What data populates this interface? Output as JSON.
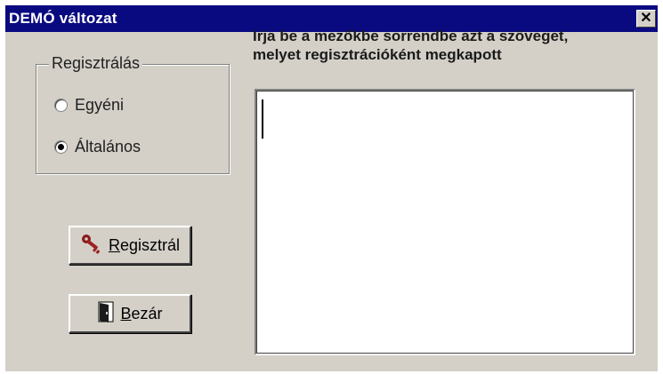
{
  "window": {
    "title": "DEMÓ változat",
    "close_glyph": "✕"
  },
  "registration_group": {
    "label": "Regisztrálás",
    "options": [
      {
        "label": "Egyéni",
        "selected": false
      },
      {
        "label": "Általános",
        "selected": true
      }
    ]
  },
  "buttons": {
    "register": {
      "label_first": "R",
      "label_rest": "egisztrál",
      "icon": "key-icon"
    },
    "close": {
      "label_first": "B",
      "label_rest": "ezár",
      "icon": "door-icon"
    }
  },
  "instruction": {
    "line1": "Irja be a mezőkbe sorrendbe  azt a szöveget,",
    "line2": "melyet regisztrációként megkapott"
  },
  "input": {
    "value": ""
  }
}
